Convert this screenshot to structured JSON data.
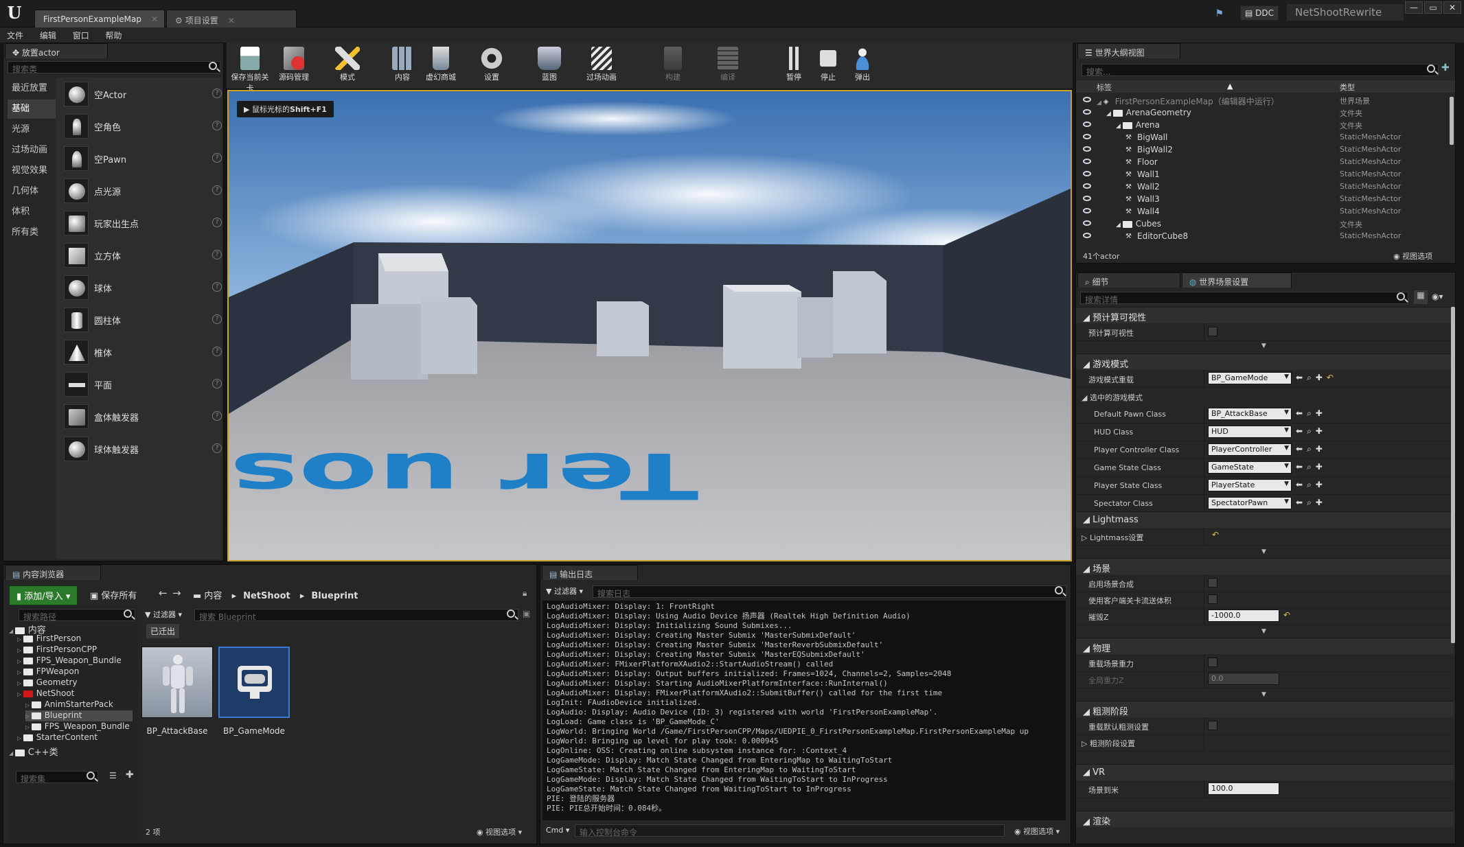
{
  "title_bar": {
    "tabs": [
      "FirstPersonExampleMap",
      "项目设置"
    ],
    "ddc_label": "DDC",
    "project_name": "NetShootRewrite",
    "window_buttons": [
      "—",
      "▭",
      "✕"
    ]
  },
  "menu": [
    "文件",
    "编辑",
    "窗口",
    "帮助"
  ],
  "place_actors": {
    "tab": "放置actor",
    "search_placeholder": "搜索类",
    "categories": [
      "最近放置",
      "基础",
      "光源",
      "过场动画",
      "视觉效果",
      "几何体",
      "体积",
      "所有类"
    ],
    "selected_category": "基础",
    "items": [
      "空Actor",
      "空角色",
      "空Pawn",
      "点光源",
      "玩家出生点",
      "立方体",
      "球体",
      "圆柱体",
      "椎体",
      "平面",
      "盒体触发器",
      "球体触发器"
    ]
  },
  "toolbar": {
    "buttons": [
      {
        "label": "保存当前关卡",
        "icon": "save-icon",
        "enabled": true
      },
      {
        "label": "源码管理",
        "icon": "source-control-icon",
        "enabled": true
      },
      {
        "label": "模式",
        "icon": "modes-icon",
        "enabled": true
      },
      {
        "label": "内容",
        "icon": "content-icon",
        "enabled": true
      },
      {
        "label": "虚幻商城",
        "icon": "marketplace-icon",
        "enabled": true
      },
      {
        "label": "设置",
        "icon": "settings-icon",
        "enabled": true
      },
      {
        "label": "蓝图",
        "icon": "blueprint-icon",
        "enabled": true
      },
      {
        "label": "过场动画",
        "icon": "cinematics-icon",
        "enabled": true
      },
      {
        "label": "构建",
        "icon": "build-icon",
        "enabled": false
      },
      {
        "label": "编译",
        "icon": "compile-icon",
        "enabled": false
      },
      {
        "label": "暂停",
        "icon": "pause-icon",
        "enabled": true
      },
      {
        "label": "停止",
        "icon": "stop-icon",
        "enabled": true
      },
      {
        "label": "弹出",
        "icon": "eject-icon",
        "enabled": true
      }
    ]
  },
  "viewport": {
    "hint_prefix": "鼠标光标的",
    "hint_key": "Shift+F1",
    "floor_text": "Ter uoszx"
  },
  "outliner": {
    "tab": "世界大纲视图",
    "search_placeholder": "搜索...",
    "col_label": "标签",
    "col_type": "类型",
    "rows": [
      {
        "name": "FirstPersonExampleMap（编辑器中运行）",
        "type": "世界场景",
        "indent": 0,
        "kind": "world",
        "dim": true
      },
      {
        "name": "ArenaGeometry",
        "type": "文件夹",
        "indent": 1,
        "kind": "folder"
      },
      {
        "name": "Arena",
        "type": "文件夹",
        "indent": 2,
        "kind": "folder"
      },
      {
        "name": "BigWall",
        "type": "StaticMeshActor",
        "indent": 3,
        "kind": "actor"
      },
      {
        "name": "BigWall2",
        "type": "StaticMeshActor",
        "indent": 3,
        "kind": "actor"
      },
      {
        "name": "Floor",
        "type": "StaticMeshActor",
        "indent": 3,
        "kind": "actor"
      },
      {
        "name": "Wall1",
        "type": "StaticMeshActor",
        "indent": 3,
        "kind": "actor"
      },
      {
        "name": "Wall2",
        "type": "StaticMeshActor",
        "indent": 3,
        "kind": "actor"
      },
      {
        "name": "Wall3",
        "type": "StaticMeshActor",
        "indent": 3,
        "kind": "actor"
      },
      {
        "name": "Wall4",
        "type": "StaticMeshActor",
        "indent": 3,
        "kind": "actor"
      },
      {
        "name": "Cubes",
        "type": "文件夹",
        "indent": 2,
        "kind": "folder"
      },
      {
        "name": "EditorCube8",
        "type": "StaticMeshActor",
        "indent": 3,
        "kind": "actor"
      }
    ],
    "count": "41个actor",
    "view_options": "视图选项"
  },
  "details": {
    "tabs": [
      "细节",
      "世界场景设置"
    ],
    "search_placeholder": "搜索详情",
    "sections": {
      "precomputed_vis": "预计算可视性",
      "precomputed_vis_prop": "预计算可视性",
      "game_mode": "游戏模式",
      "game_mode_override": "游戏模式重载",
      "game_mode_override_value": "BP_GameMode",
      "selected_game_mode": "选中的游戏模式",
      "classes": [
        {
          "label": "Default Pawn Class",
          "value": "BP_AttackBase"
        },
        {
          "label": "HUD Class",
          "value": "HUD"
        },
        {
          "label": "Player Controller Class",
          "value": "PlayerController"
        },
        {
          "label": "Game State Class",
          "value": "GameState"
        },
        {
          "label": "Player State Class",
          "value": "PlayerState"
        },
        {
          "label": "Spectator Class",
          "value": "SpectatorPawn"
        }
      ],
      "lightmass": "Lightmass",
      "lightmass_settings": "Lightmass设置",
      "world": "场景",
      "world_composition": "启用场景合成",
      "client_streaming": "使用客户端关卡流送体积",
      "kill_z": "摧毁Z",
      "kill_z_value": "-1000.0",
      "physics": "物理",
      "override_gravity": "重载场景重力",
      "global_gravity_z": "全局重力Z",
      "global_gravity_z_value": "0.0",
      "broadphase": "粗测阶段",
      "override_broadphase": "重载默认粗测设置",
      "broadphase_settings": "粗测阶段设置",
      "vr": "VR",
      "world_to_meters": "场景到米",
      "world_to_meters_value": "100.0",
      "rendering": "渲染"
    }
  },
  "content_browser": {
    "tab": "内容浏览器",
    "add_import": "添加/导入",
    "save_all": "保存所有",
    "path": [
      "内容",
      "NetShoot",
      "Blueprint"
    ],
    "search_paths": "搜索路径",
    "filters": "过滤器",
    "search_assets": "搜索 Blueprint",
    "checked_out": "已迁出",
    "tree": [
      {
        "name": "内容",
        "indent": 0,
        "root": true
      },
      {
        "name": "FirstPerson",
        "indent": 1
      },
      {
        "name": "FirstPersonCPP",
        "indent": 1
      },
      {
        "name": "FPS_Weapon_Bundle",
        "indent": 1
      },
      {
        "name": "FPWeapon",
        "indent": 1
      },
      {
        "name": "Geometry",
        "indent": 1
      },
      {
        "name": "NetShoot",
        "indent": 1,
        "red": true
      },
      {
        "name": "AnimStarterPack",
        "indent": 2
      },
      {
        "name": "Blueprint",
        "indent": 2,
        "selected": true
      },
      {
        "name": "FPS_Weapon_Bundle",
        "indent": 2
      },
      {
        "name": "StarterContent",
        "indent": 1
      },
      {
        "name": "C++类",
        "indent": 0,
        "root": true
      }
    ],
    "search_collections": "搜索集",
    "assets": [
      "BP_AttackBase",
      "BP_GameMode"
    ],
    "item_count": "2 项",
    "view_options": "视图选项"
  },
  "output_log": {
    "tab": "输出日志",
    "filters": "过滤器",
    "search_placeholder": "搜索日志",
    "lines": [
      "LogAudioMixer: Display: 1: FrontRight",
      "LogAudioMixer: Display: Using Audio Device 扬声器 (Realtek High Definition Audio)",
      "LogAudioMixer: Display: Initializing Sound Submixes...",
      "LogAudioMixer: Display: Creating Master Submix 'MasterSubmixDefault'",
      "LogAudioMixer: Display: Creating Master Submix 'MasterReverbSubmixDefault'",
      "LogAudioMixer: Display: Creating Master Submix 'MasterEQSubmixDefault'",
      "LogAudioMixer: FMixerPlatformXAudio2::StartAudioStream() called",
      "LogAudioMixer: Display: Output buffers initialized: Frames=1024, Channels=2, Samples=2048",
      "LogAudioMixer: Display: Starting AudioMixerPlatformInterface::RunInternal()",
      "LogAudioMixer: Display: FMixerPlatformXAudio2::SubmitBuffer() called for the first time",
      "LogInit: FAudioDevice initialized.",
      "LogAudio: Display: Audio Device (ID: 3) registered with world 'FirstPersonExampleMap'.",
      "LogLoad: Game class is 'BP_GameMode_C'",
      "LogWorld: Bringing World /Game/FirstPersonCPP/Maps/UEDPIE_0_FirstPersonExampleMap.FirstPersonExampleMap up",
      "LogWorld: Bringing up level for play took: 0.000945",
      "LogOnline: OSS: Creating online subsystem instance for: :Context_4",
      "LogGameMode: Display: Match State Changed from EnteringMap to WaitingToStart",
      "LogGameState: Match State Changed from EnteringMap to WaitingToStart",
      "LogGameMode: Display: Match State Changed from WaitingToStart to InProgress",
      "LogGameState: Match State Changed from WaitingToStart to InProgress",
      "PIE: 登陆的服务器",
      "PIE: PIE总开始时间：0.084秒。"
    ],
    "cmd_label": "Cmd",
    "cmd_placeholder": "输入控制台命令",
    "view_options": "视图选项"
  },
  "colors": {
    "accent_gold": "#c9a227",
    "add_button_green": "#2b7a2b",
    "sky_top": "#3b6fb0",
    "floor_text_blue": "#1f7fc7"
  }
}
